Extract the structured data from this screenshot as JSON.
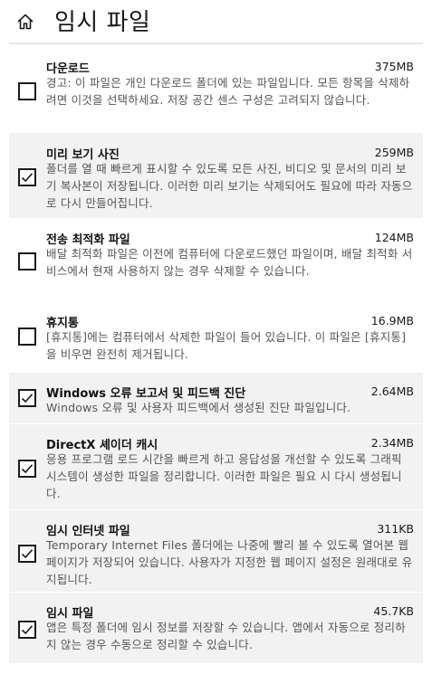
{
  "header": {
    "title": "임시 파일",
    "home_icon": "home-icon"
  },
  "items": [
    {
      "title": "다운로드",
      "size": "375MB",
      "checked": false,
      "description": "경고: 이 파일은 개인 다운로드 폴더에 있는 파일입니다. 모든 항목을 삭제하려면 이것을 선택하세요. 저장 공간 센스 구성은 고려되지 않습니다."
    },
    {
      "title": "미리 보기 사진",
      "size": "259MB",
      "checked": true,
      "description": "폴더를 열 때 빠르게 표시할 수 있도록 모든 사진, 비디오 및 문서의 미리 보기 복사본이 저장됩니다. 이러한 미리 보기는 삭제되어도 필요에 따라 자동으로 다시 만들어집니다."
    },
    {
      "title": "전송 최적화 파일",
      "size": "124MB",
      "checked": false,
      "description": "배달 최적화 파일은 이전에 컴퓨터에 다운로드했던 파일이며, 배달 최적화 서비스에서 현재 사용하지 않는 경우 삭제할 수 있습니다."
    },
    {
      "title": "휴지통",
      "size": "16.9MB",
      "checked": false,
      "description": "[휴지통]에는 컴퓨터에서 삭제한 파일이 들어 있습니다. 이 파일은 [휴지통]을 비우면 완전히 제거됩니다."
    },
    {
      "title": "Windows 오류 보고서 및 피드백 진단",
      "size": "2.64MB",
      "checked": true,
      "description": "Windows 오류 및 사용자 피드백에서 생성된 진단 파일입니다."
    },
    {
      "title": "DirectX 셰이더 캐시",
      "size": "2.34MB",
      "checked": true,
      "description": "응용 프로그램 로드 시간을 빠르게 하고 응답성을 개선할 수 있도록 그래픽 시스템이 생성한 파일을 정리합니다. 이러한 파일은 필요 시 다시 생성됩니다."
    },
    {
      "title": "임시 인터넷 파일",
      "size": "311KB",
      "checked": true,
      "description": "Temporary Internet Files 폴더에는 나중에 빨리 볼 수 있도록 열어본 웹 페이지가 저장되어 있습니다. 사용자가 지정한 웹 페이지 설정은 원래대로 유지됩니다."
    },
    {
      "title": "임시 파일",
      "size": "45.7KB",
      "checked": true,
      "description": "앱은 특정 폴더에 임시 정보를 저장할 수 있습니다. 앱에서 자동으로 정리하지 않는 경우 수동으로 정리할 수 있습니다."
    }
  ]
}
